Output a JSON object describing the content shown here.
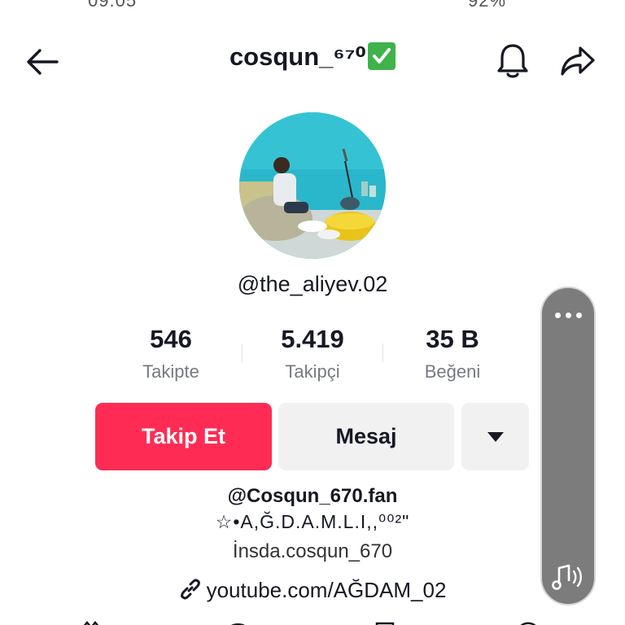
{
  "status_bar": {
    "time": "09:05",
    "battery": "92%"
  },
  "header": {
    "title": "cosqun_⁶⁷⁰",
    "verified_icon": "green-check-emoji-icon"
  },
  "profile": {
    "handle": "@the_aliyev.02",
    "avatar_description": "profile-photo"
  },
  "stats": [
    {
      "value": "546",
      "label": "Takipte"
    },
    {
      "value": "5.419",
      "label": "Takipçi"
    },
    {
      "value": "35 B",
      "label": "Beğeni"
    }
  ],
  "actions": {
    "follow_label": "Takip Et",
    "message_label": "Mesaj"
  },
  "bio": {
    "line1": "@Cosqun_670.fan",
    "line2": "☆•A,Ğ.D.A.M.L.I,,⁰⁰²\"",
    "line3": "İnsda.cosqun_670",
    "link": "youtube.com/AĞDAM_02"
  },
  "colors": {
    "accent": "#fe2c55",
    "secondary_button": "#f1f1f2",
    "text": "#161823",
    "muted": "#777a82",
    "side_panel": "#7c7c7c"
  }
}
